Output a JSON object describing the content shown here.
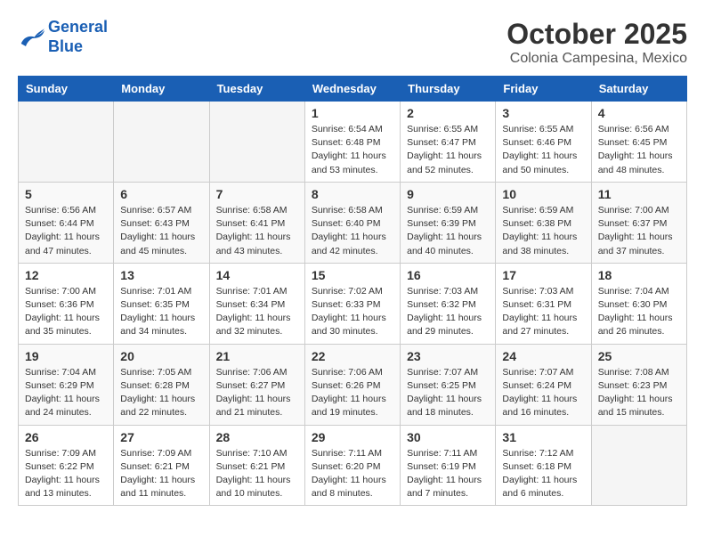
{
  "logo": {
    "line1": "General",
    "line2": "Blue"
  },
  "calendar": {
    "month_year": "October 2025",
    "location": "Colonia Campesina, Mexico",
    "days_of_week": [
      "Sunday",
      "Monday",
      "Tuesday",
      "Wednesday",
      "Thursday",
      "Friday",
      "Saturday"
    ],
    "weeks": [
      [
        {
          "day": "",
          "info": ""
        },
        {
          "day": "",
          "info": ""
        },
        {
          "day": "",
          "info": ""
        },
        {
          "day": "1",
          "info": "Sunrise: 6:54 AM\nSunset: 6:48 PM\nDaylight: 11 hours\nand 53 minutes."
        },
        {
          "day": "2",
          "info": "Sunrise: 6:55 AM\nSunset: 6:47 PM\nDaylight: 11 hours\nand 52 minutes."
        },
        {
          "day": "3",
          "info": "Sunrise: 6:55 AM\nSunset: 6:46 PM\nDaylight: 11 hours\nand 50 minutes."
        },
        {
          "day": "4",
          "info": "Sunrise: 6:56 AM\nSunset: 6:45 PM\nDaylight: 11 hours\nand 48 minutes."
        }
      ],
      [
        {
          "day": "5",
          "info": "Sunrise: 6:56 AM\nSunset: 6:44 PM\nDaylight: 11 hours\nand 47 minutes."
        },
        {
          "day": "6",
          "info": "Sunrise: 6:57 AM\nSunset: 6:43 PM\nDaylight: 11 hours\nand 45 minutes."
        },
        {
          "day": "7",
          "info": "Sunrise: 6:58 AM\nSunset: 6:41 PM\nDaylight: 11 hours\nand 43 minutes."
        },
        {
          "day": "8",
          "info": "Sunrise: 6:58 AM\nSunset: 6:40 PM\nDaylight: 11 hours\nand 42 minutes."
        },
        {
          "day": "9",
          "info": "Sunrise: 6:59 AM\nSunset: 6:39 PM\nDaylight: 11 hours\nand 40 minutes."
        },
        {
          "day": "10",
          "info": "Sunrise: 6:59 AM\nSunset: 6:38 PM\nDaylight: 11 hours\nand 38 minutes."
        },
        {
          "day": "11",
          "info": "Sunrise: 7:00 AM\nSunset: 6:37 PM\nDaylight: 11 hours\nand 37 minutes."
        }
      ],
      [
        {
          "day": "12",
          "info": "Sunrise: 7:00 AM\nSunset: 6:36 PM\nDaylight: 11 hours\nand 35 minutes."
        },
        {
          "day": "13",
          "info": "Sunrise: 7:01 AM\nSunset: 6:35 PM\nDaylight: 11 hours\nand 34 minutes."
        },
        {
          "day": "14",
          "info": "Sunrise: 7:01 AM\nSunset: 6:34 PM\nDaylight: 11 hours\nand 32 minutes."
        },
        {
          "day": "15",
          "info": "Sunrise: 7:02 AM\nSunset: 6:33 PM\nDaylight: 11 hours\nand 30 minutes."
        },
        {
          "day": "16",
          "info": "Sunrise: 7:03 AM\nSunset: 6:32 PM\nDaylight: 11 hours\nand 29 minutes."
        },
        {
          "day": "17",
          "info": "Sunrise: 7:03 AM\nSunset: 6:31 PM\nDaylight: 11 hours\nand 27 minutes."
        },
        {
          "day": "18",
          "info": "Sunrise: 7:04 AM\nSunset: 6:30 PM\nDaylight: 11 hours\nand 26 minutes."
        }
      ],
      [
        {
          "day": "19",
          "info": "Sunrise: 7:04 AM\nSunset: 6:29 PM\nDaylight: 11 hours\nand 24 minutes."
        },
        {
          "day": "20",
          "info": "Sunrise: 7:05 AM\nSunset: 6:28 PM\nDaylight: 11 hours\nand 22 minutes."
        },
        {
          "day": "21",
          "info": "Sunrise: 7:06 AM\nSunset: 6:27 PM\nDaylight: 11 hours\nand 21 minutes."
        },
        {
          "day": "22",
          "info": "Sunrise: 7:06 AM\nSunset: 6:26 PM\nDaylight: 11 hours\nand 19 minutes."
        },
        {
          "day": "23",
          "info": "Sunrise: 7:07 AM\nSunset: 6:25 PM\nDaylight: 11 hours\nand 18 minutes."
        },
        {
          "day": "24",
          "info": "Sunrise: 7:07 AM\nSunset: 6:24 PM\nDaylight: 11 hours\nand 16 minutes."
        },
        {
          "day": "25",
          "info": "Sunrise: 7:08 AM\nSunset: 6:23 PM\nDaylight: 11 hours\nand 15 minutes."
        }
      ],
      [
        {
          "day": "26",
          "info": "Sunrise: 7:09 AM\nSunset: 6:22 PM\nDaylight: 11 hours\nand 13 minutes."
        },
        {
          "day": "27",
          "info": "Sunrise: 7:09 AM\nSunset: 6:21 PM\nDaylight: 11 hours\nand 11 minutes."
        },
        {
          "day": "28",
          "info": "Sunrise: 7:10 AM\nSunset: 6:21 PM\nDaylight: 11 hours\nand 10 minutes."
        },
        {
          "day": "29",
          "info": "Sunrise: 7:11 AM\nSunset: 6:20 PM\nDaylight: 11 hours\nand 8 minutes."
        },
        {
          "day": "30",
          "info": "Sunrise: 7:11 AM\nSunset: 6:19 PM\nDaylight: 11 hours\nand 7 minutes."
        },
        {
          "day": "31",
          "info": "Sunrise: 7:12 AM\nSunset: 6:18 PM\nDaylight: 11 hours\nand 6 minutes."
        },
        {
          "day": "",
          "info": ""
        }
      ]
    ]
  }
}
